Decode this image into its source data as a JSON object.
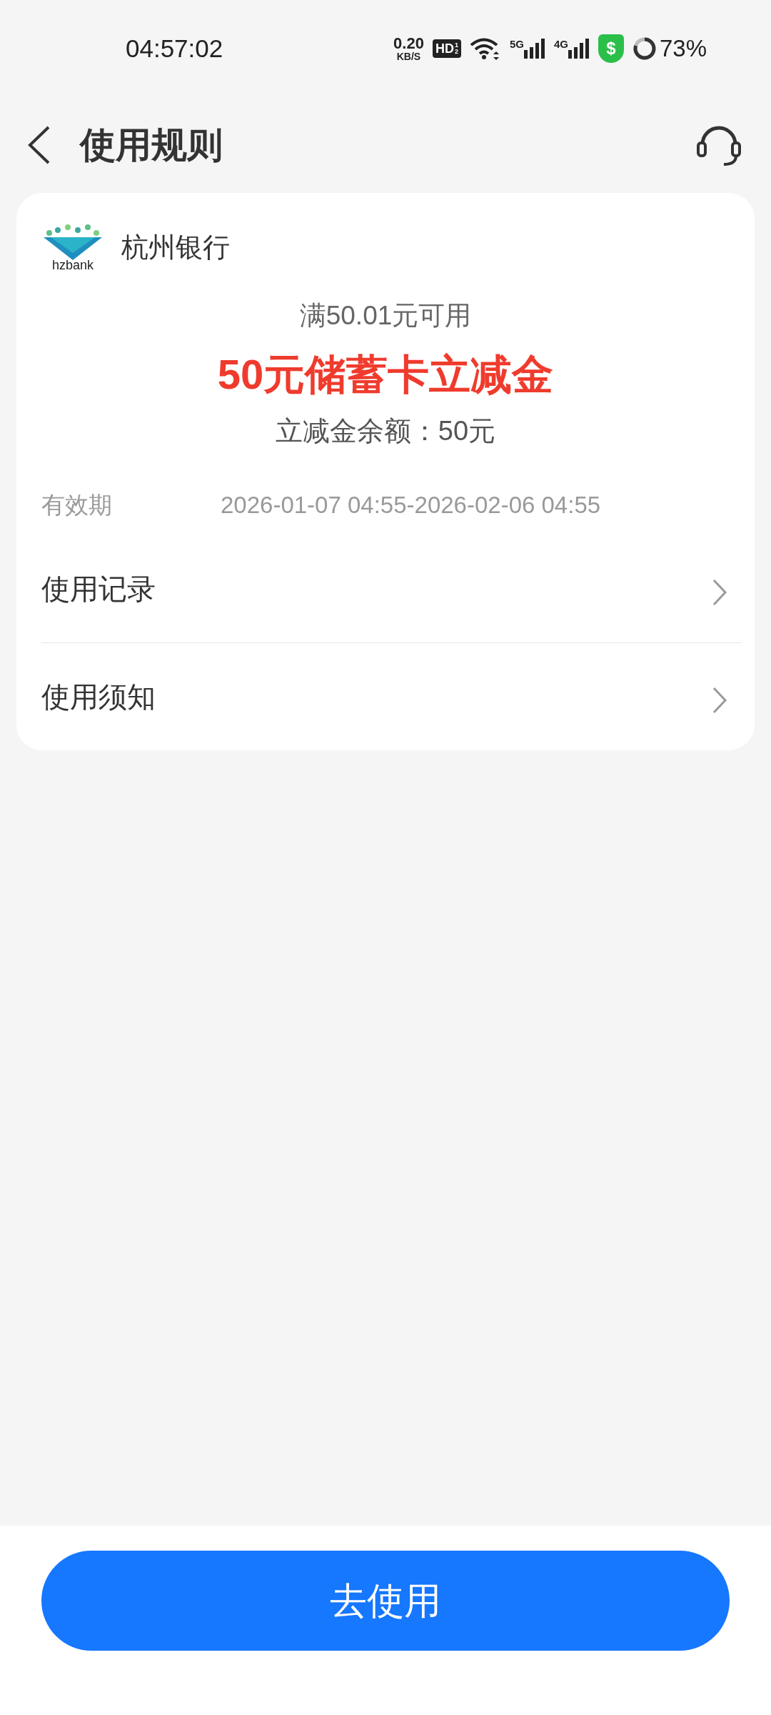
{
  "status_bar": {
    "time": "04:57:02",
    "net_speed": "0.20",
    "net_unit": "KB/S",
    "hd_badge": "HD",
    "hd_sims": [
      "1",
      "2"
    ],
    "signals": [
      "5G",
      "4G"
    ],
    "shield_symbol": "$",
    "battery": "73%"
  },
  "header": {
    "title": "使用规则"
  },
  "card": {
    "logo_text": "hzbank",
    "bank_name": "杭州银行",
    "condition": "满50.01元可用",
    "title": "50元储蓄卡立减金",
    "balance": "立减金余额：50元",
    "validity_label": "有效期",
    "validity_value": "2026-01-07 04:55-2026-02-06 04:55",
    "links": [
      {
        "label": "使用记录"
      },
      {
        "label": "使用须知"
      }
    ]
  },
  "button": {
    "label": "去使用"
  }
}
